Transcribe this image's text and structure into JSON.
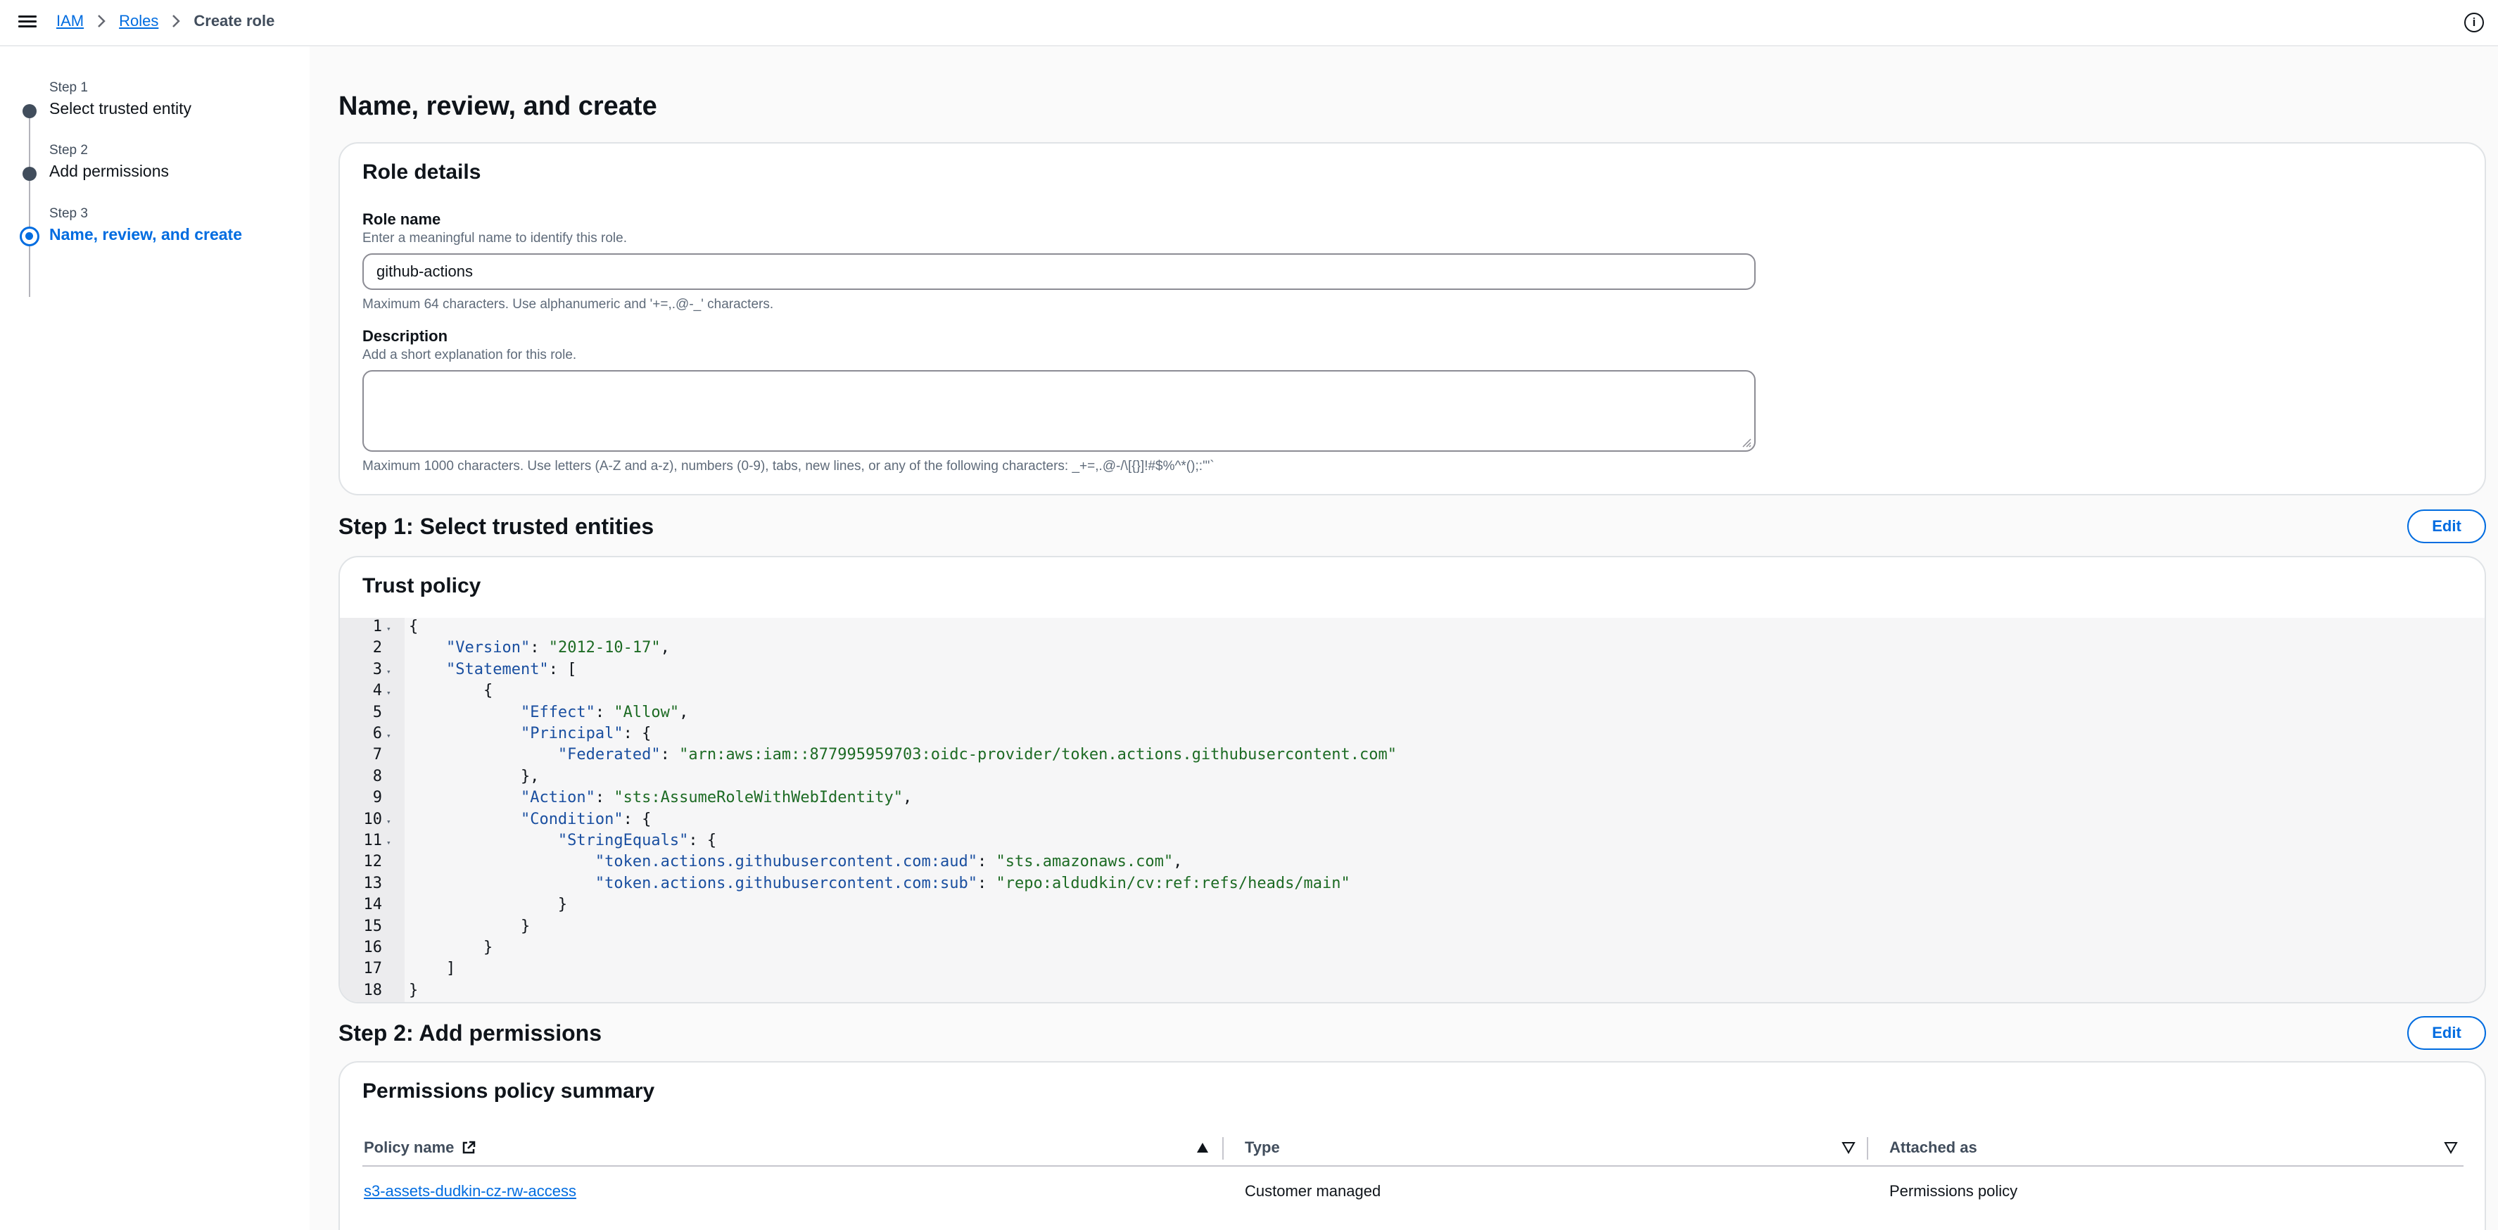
{
  "breadcrumb": {
    "items": [
      "IAM",
      "Roles"
    ],
    "current": "Create role"
  },
  "steps": [
    {
      "label": "Step 1",
      "title": "Select trusted entity"
    },
    {
      "label": "Step 2",
      "title": "Add permissions"
    },
    {
      "label": "Step 3",
      "title": "Name, review, and create"
    }
  ],
  "page": {
    "title": "Name, review, and create"
  },
  "role_details": {
    "heading": "Role details",
    "role_name_label": "Role name",
    "role_name_desc": "Enter a meaningful name to identify this role.",
    "role_name_value": "github-actions",
    "role_name_constraint": "Maximum 64 characters. Use alphanumeric and '+=,.@-_' characters.",
    "description_label": "Description",
    "description_desc": "Add a short explanation for this role.",
    "description_value": "",
    "description_constraint": "Maximum 1000 characters. Use letters (A-Z and a-z), numbers (0-9), tabs, new lines, or any of the following characters: _+=,.@-/\\[{}]!#$%^*();:'\"`"
  },
  "step1": {
    "title": "Step 1: Select trusted entities",
    "edit_label": "Edit",
    "heading": "Trust policy",
    "code_lines": [
      "{",
      "    \"Version\": \"2012-10-17\",",
      "    \"Statement\": [",
      "        {",
      "            \"Effect\": \"Allow\",",
      "            \"Principal\": {",
      "                \"Federated\": \"arn:aws:iam::877995959703:oidc-provider/token.actions.githubusercontent.com\"",
      "            },",
      "            \"Action\": \"sts:AssumeRoleWithWebIdentity\",",
      "            \"Condition\": {",
      "                \"StringEquals\": {",
      "                    \"token.actions.githubusercontent.com:aud\": \"sts.amazonaws.com\",",
      "                    \"token.actions.githubusercontent.com:sub\": \"repo:aldudkin/cv:ref:refs/heads/main\"",
      "                }",
      "            }",
      "        }",
      "    ]",
      "}"
    ],
    "foldable_lines": [
      1,
      3,
      4,
      6,
      10,
      11
    ]
  },
  "step2": {
    "title": "Step 2: Add permissions",
    "edit_label": "Edit",
    "heading": "Permissions policy summary",
    "columns": [
      "Policy name",
      "Type",
      "Attached as"
    ],
    "rows": [
      {
        "policy_name": "s3-assets-dudkin-cz-rw-access",
        "type": "Customer managed",
        "attached_as": "Permissions policy"
      }
    ]
  },
  "colors": {
    "accent": "#006ce0",
    "text": "#0f141a",
    "muted": "#5f6b7a"
  }
}
